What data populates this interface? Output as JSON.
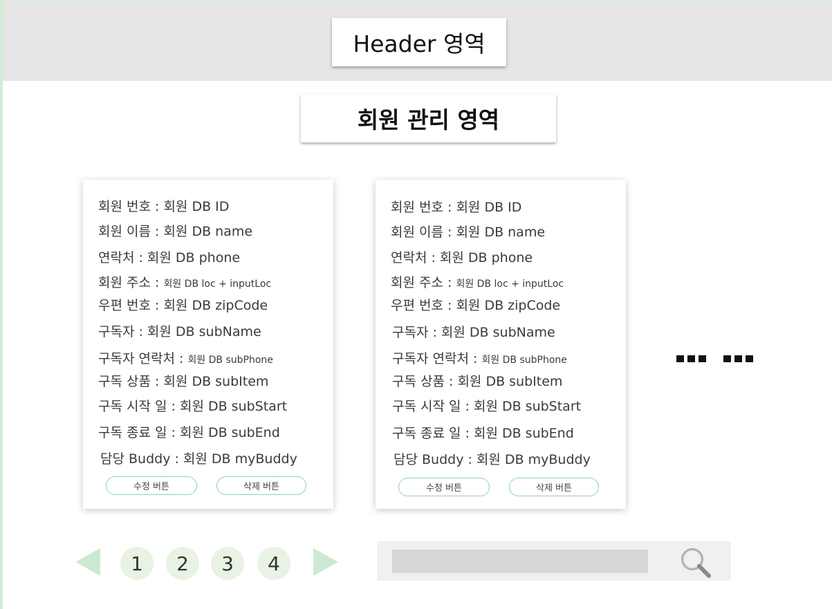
{
  "header": {
    "title": "Header 영역"
  },
  "section": {
    "title": "회원 관리 영역"
  },
  "cards": [
    {
      "fields": [
        {
          "text": "회원 번호 : 회원 DB ID"
        },
        {
          "text": "회원 이름 : 회원 DB name"
        },
        {
          "text": "연락처 : 회원 DB phone"
        },
        {
          "label": "회원 주소 : ",
          "value": "회원 DB loc + inputLoc"
        },
        {
          "text": "우편 번호 : 회원 DB zipCode"
        },
        {
          "text": "구독자 : 회원 DB subName"
        },
        {
          "label": "구독자 연락처 : ",
          "value": "회원 DB subPhone"
        },
        {
          "text": "구독 상품 : 회원 DB subItem"
        },
        {
          "text": "구독 시작 일 : 회원 DB subStart"
        },
        {
          "text": "구독 종료 일 : 회원 DB subEnd"
        },
        {
          "text": "담당 Buddy : 회원 DB myBuddy"
        }
      ],
      "edit_label": "수정 버튼",
      "delete_label": "삭제 버튼"
    },
    {
      "fields": [
        {
          "text": "회원 번호 : 회원 DB ID"
        },
        {
          "text": "회원 이름 : 회원 DB name"
        },
        {
          "text": "연락처 : 회원 DB phone"
        },
        {
          "label": "회원 주소 : ",
          "value": "회원 DB loc + inputLoc"
        },
        {
          "text": "우편 번호 : 회원 DB zipCode"
        },
        {
          "text": "구독자 : 회원 DB subName"
        },
        {
          "label": "구독자 연락처 : ",
          "value": "회원 DB subPhone"
        },
        {
          "text": "구독 상품 : 회원 DB subItem"
        },
        {
          "text": "구독 시작 일 : 회원 DB subStart"
        },
        {
          "text": "구독 종료 일 : 회원 DB subEnd"
        },
        {
          "text": "담당 Buddy : 회원 DB myBuddy"
        }
      ],
      "edit_label": "수정 버튼",
      "delete_label": "삭제 버튼"
    }
  ],
  "pagination": {
    "pages": [
      "1",
      "2",
      "3",
      "4"
    ]
  },
  "search": {
    "placeholder": ""
  },
  "colors": {
    "accent": "#8fd1a8",
    "pager_bg": "#e8f3e3",
    "arrow": "#cce9d2"
  }
}
